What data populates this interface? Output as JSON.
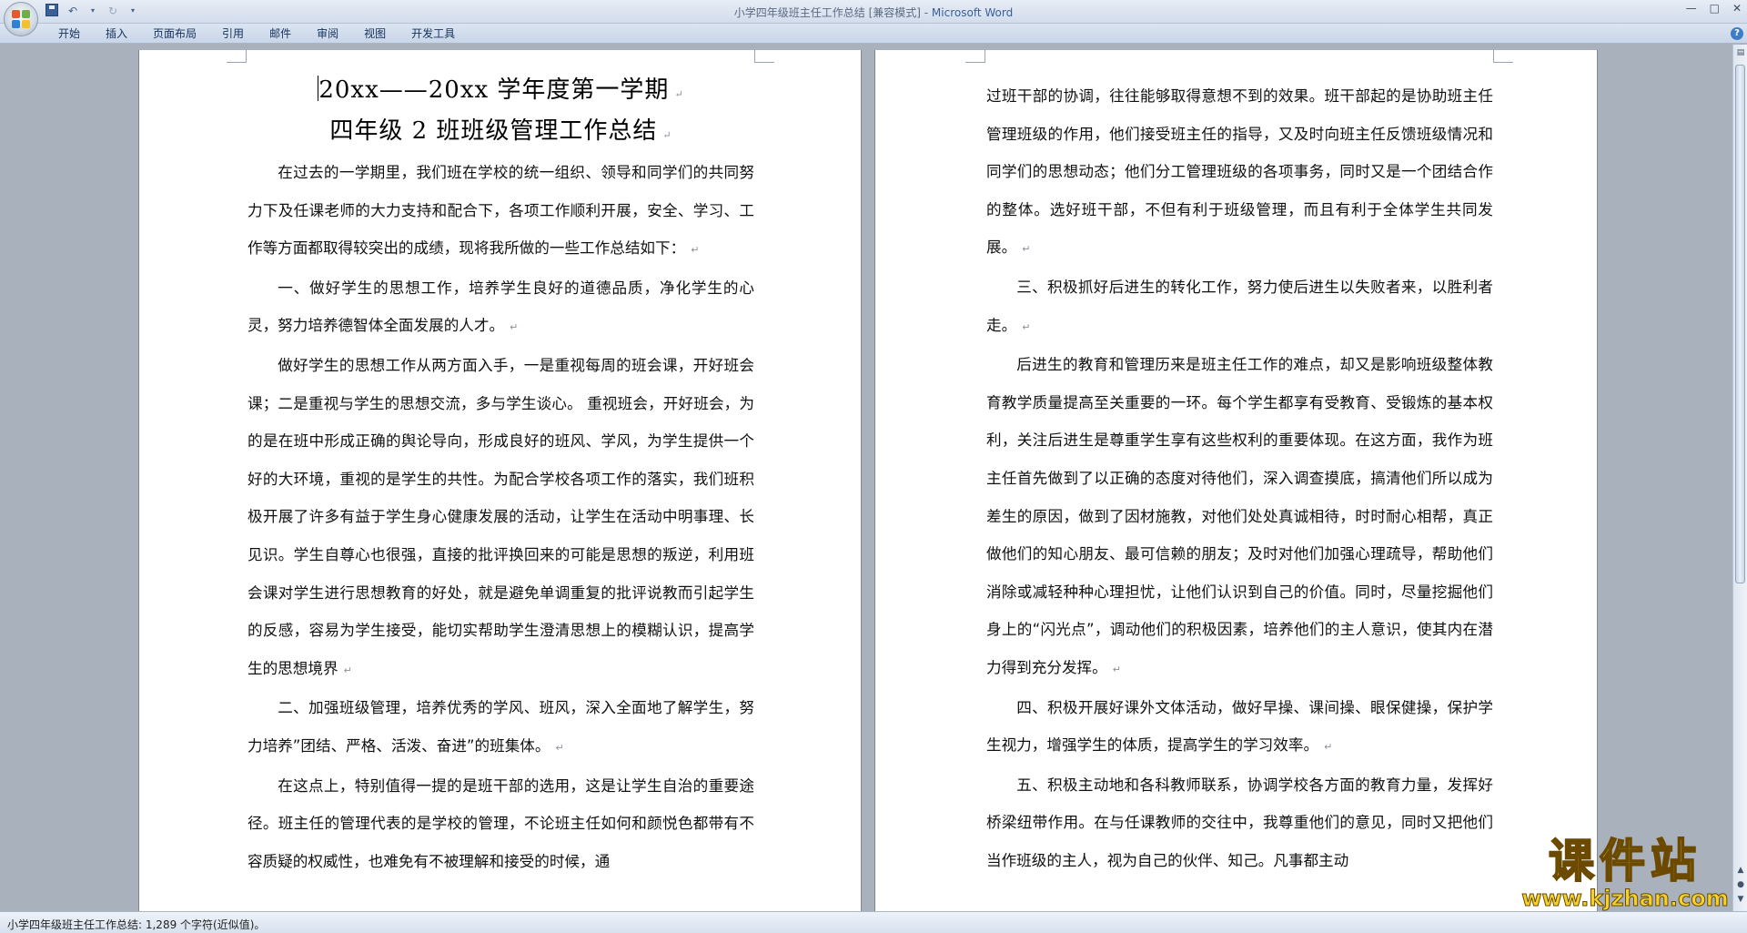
{
  "window": {
    "title": "小学四年级班主任工作总结 [兼容模式] - ",
    "app_name": "Microsoft Word",
    "controls": [
      "—",
      "□",
      "✕"
    ]
  },
  "ribbon": {
    "tabs": [
      "开始",
      "插入",
      "页面布局",
      "引用",
      "邮件",
      "审阅",
      "视图",
      "开发工具"
    ]
  },
  "document": {
    "title_line1": "20xx——20xx 学年度第一学期",
    "title_line2": "四年级 2 班班级管理工作总结",
    "paragraph_mark": "↵",
    "page1_paragraphs": [
      "在过去的一学期里，我们班在学校的统一组织、领导和同学们的共同努力下及任课老师的大力支持和配合下，各项工作顺利开展，安全、学习、工作等方面都取得较突出的成绩，现将我所做的一些工作总结如下：",
      "一、做好学生的思想工作，培养学生良好的道德品质，净化学生的心灵，努力培养德智体全面发展的人才。",
      "做好学生的思想工作从两方面入手，一是重视每周的班会课，开好班会课；二是重视与学生的思想交流，多与学生谈心。 重视班会，开好班会，为的是在班中形成正确的舆论导向，形成良好的班风、学风，为学生提供一个好的大环境，重视的是学生的共性。为配合学校各项工作的落实，我们班积极开展了许多有益于学生身心健康发展的活动，让学生在活动中明事理、长见识。学生自尊心也很强，直接的批评换回来的可能是思想的叛逆，利用班会课对学生进行思想教育的好处，就是避免单调重复的批评说教而引起学生的反感，容易为学生接受，能切实帮助学生澄清思想上的模糊认识，提高学生的思想境界",
      "二、加强班级管理，培养优秀的学风、班风，深入全面地了解学生，努力培养”团结、严格、活泼、奋进”的班集体。",
      "在这点上，特别值得一提的是班干部的选用，这是让学生自治的重要途径。班主任的管理代表的是学校的管理，不论班主任如何和颜悦色都带有不容质疑的权威性，也难免有不被理解和接受的时候，通"
    ],
    "page2_paragraphs": [
      "过班干部的协调，往往能够取得意想不到的效果。班干部起的是协助班主任管理班级的作用，他们接受班主任的指导，又及时向班主任反馈班级情况和同学们的思想动态；他们分工管理班级的各项事务，同时又是一个团结合作的整体。选好班干部，不但有利于班级管理，而且有利于全体学生共同发展。",
      "三、积极抓好后进生的转化工作，努力使后进生以失败者来，以胜利者走。",
      "后进生的教育和管理历来是班主任工作的难点，却又是影响班级整体教育教学质量提高至关重要的一环。每个学生都享有受教育、受锻炼的基本权利，关注后进生是尊重学生享有这些权利的重要体现。在这方面，我作为班主任首先做到了以正确的态度对待他们，深入调查摸底，搞清他们所以成为差生的原因，做到了因材施教，对他们处处真诚相待，时时耐心相帮，真正做他们的知心朋友、最可信赖的朋友；及时对他们加强心理疏导，帮助他们消除或减轻种种心理担忧，让他们认识到自己的价值。同时，尽量挖掘他们身上的“闪光点”，调动他们的积极因素，培养他们的主人意识，使其内在潜力得到充分发挥。",
      "四、积极开展好课外文体活动，做好早操、课间操、眼保健操，保护学生视力，增强学生的体质，提高学生的学习效率。",
      "五、积极主动地和各科教师联系，协调学校各方面的教育力量，发挥好桥梁纽带作用。在与任课教师的交往中，我尊重他们的意见，同时又把他们当作班级的主人，视为自己的伙伴、知己。凡事都主动"
    ]
  },
  "statusbar": {
    "text": "小学四年级班主任工作总结: 1,289 个字符(近似值)。"
  },
  "watermark": {
    "text": "课件站",
    "url": "www.kjzhan.com"
  },
  "colors": {
    "ribbon_tab_text": "#15315a",
    "workspace_bg": "#a9b1bd",
    "watermark_yellow": "#f2d22a"
  }
}
